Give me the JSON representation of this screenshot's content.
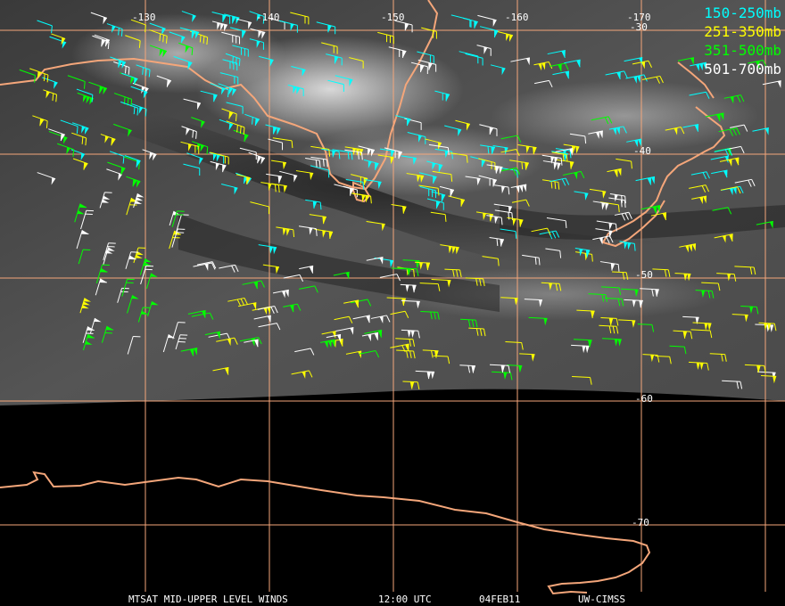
{
  "legend": [
    {
      "label": "150-250mb",
      "color": "#00ffff"
    },
    {
      "label": "251-350mb",
      "color": "#ffff00"
    },
    {
      "label": "351-500mb",
      "color": "#00ff00"
    },
    {
      "label": "501-700mb",
      "color": "#ffffff"
    }
  ],
  "grid": {
    "line_color": "#f4a67a",
    "longitudes": [
      "-130",
      "-140",
      "-150",
      "-160",
      "-170"
    ],
    "latitudes": [
      "-30",
      "-40",
      "-50",
      "-60",
      "-70"
    ]
  },
  "coastline_color": "#f4a67a",
  "footer": {
    "product": "MTSAT MID-UPPER LEVEL WINDS",
    "time": "12:00 UTC",
    "date": "04FEB11",
    "source": "UW-CIMSS"
  }
}
